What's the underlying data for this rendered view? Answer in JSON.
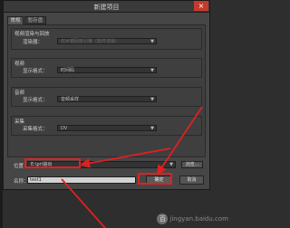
{
  "dialog": {
    "title": "新建项目",
    "close_label": "×"
  },
  "tabs": [
    {
      "label": "常规",
      "active": true
    },
    {
      "label": "暂存盘",
      "active": false
    }
  ],
  "sections": {
    "video_rendering": {
      "title": "视频渲染与回放",
      "renderer_label": "渲染器：",
      "renderer_value": "仅水银回放引擎（软件渲染）"
    },
    "video": {
      "title": "视频",
      "display_format_label": "显示格式：",
      "display_format_value": "时间码"
    },
    "audio": {
      "title": "音频",
      "display_format_label": "显示格式：",
      "display_format_value": "音频采样"
    },
    "capture": {
      "title": "采集",
      "format_label": "采集格式：",
      "format_value": "DV"
    }
  },
  "bottom": {
    "location_label": "位置：",
    "location_value": "E:\\pr\\输出",
    "browse_label": "浏览...",
    "name_label": "名称：",
    "name_value": "test1",
    "ok_label": "确定",
    "cancel_label": "取消"
  },
  "watermark": {
    "badge": "百",
    "text": "jingyan.baidu.com"
  },
  "colors": {
    "dialog_bg": "#464646",
    "panel_bg": "#3f3f3f",
    "highlight": "#e02020",
    "close_button": "#c7392b"
  }
}
